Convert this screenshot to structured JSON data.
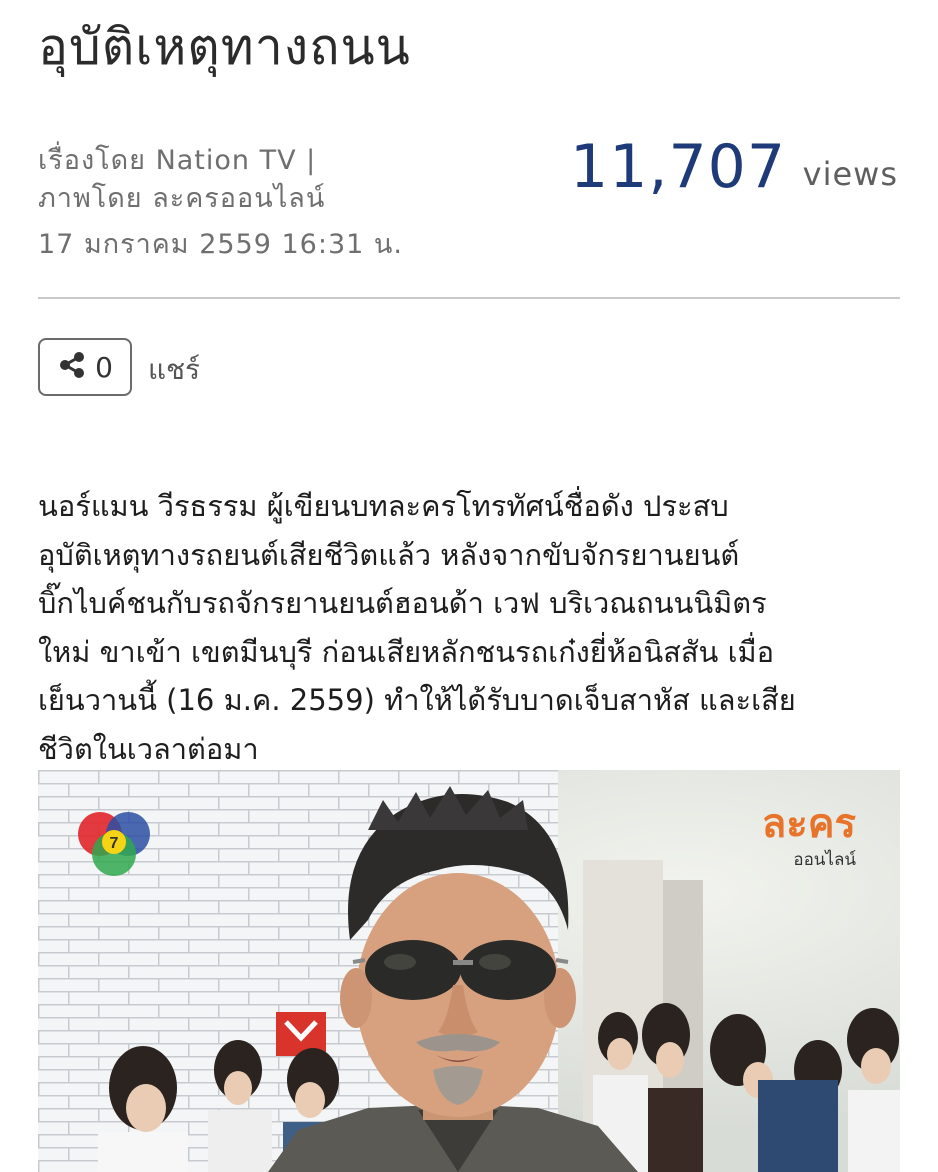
{
  "article": {
    "title": "อุบัติเหตุทางถนน",
    "byline": "เรื่องโดย Nation TV |",
    "photo_credit": "ภาพโดย ละครออนไลน์",
    "date": "17 มกราคม 2559 16:31 น.",
    "views_count": "11,707",
    "views_label": "views",
    "share": {
      "count": "0",
      "label": "แชร์",
      "icon": "share-icon"
    },
    "body_lines": [
      "นอร์แมน วีรธรรม ผู้เขียนบทละครโทรทัศน์ชื่อดัง ประสบ",
      "อุบัติเหตุทางรถยนต์เสียชีวิตแล้ว หลังจากขับจักรยานยนต์",
      "บิ๊กไบค์ชนกับรถจักรยานยนต์ฮอนด้า เวฟ บริเวณถนนนิมิตร",
      "ใหม่ ขาเข้า เขตมีนบุรี ก่อนเสียหลักชนรถเก๋งยี่ห้อนิสสัน เมื่อ",
      "เย็นวานนี้ (16 ม.ค. 2559) ทำให้ได้รับบาดเจ็บสาหัส และเสีย",
      "ชีวิตในเวลาต่อมา"
    ]
  },
  "photo": {
    "channel_logo_text": "7",
    "watermark_word": "ละคร",
    "watermark_sub": "ออนไลน์"
  },
  "colors": {
    "views_accent": "#1e3a78",
    "divider": "#c9c9c9"
  }
}
